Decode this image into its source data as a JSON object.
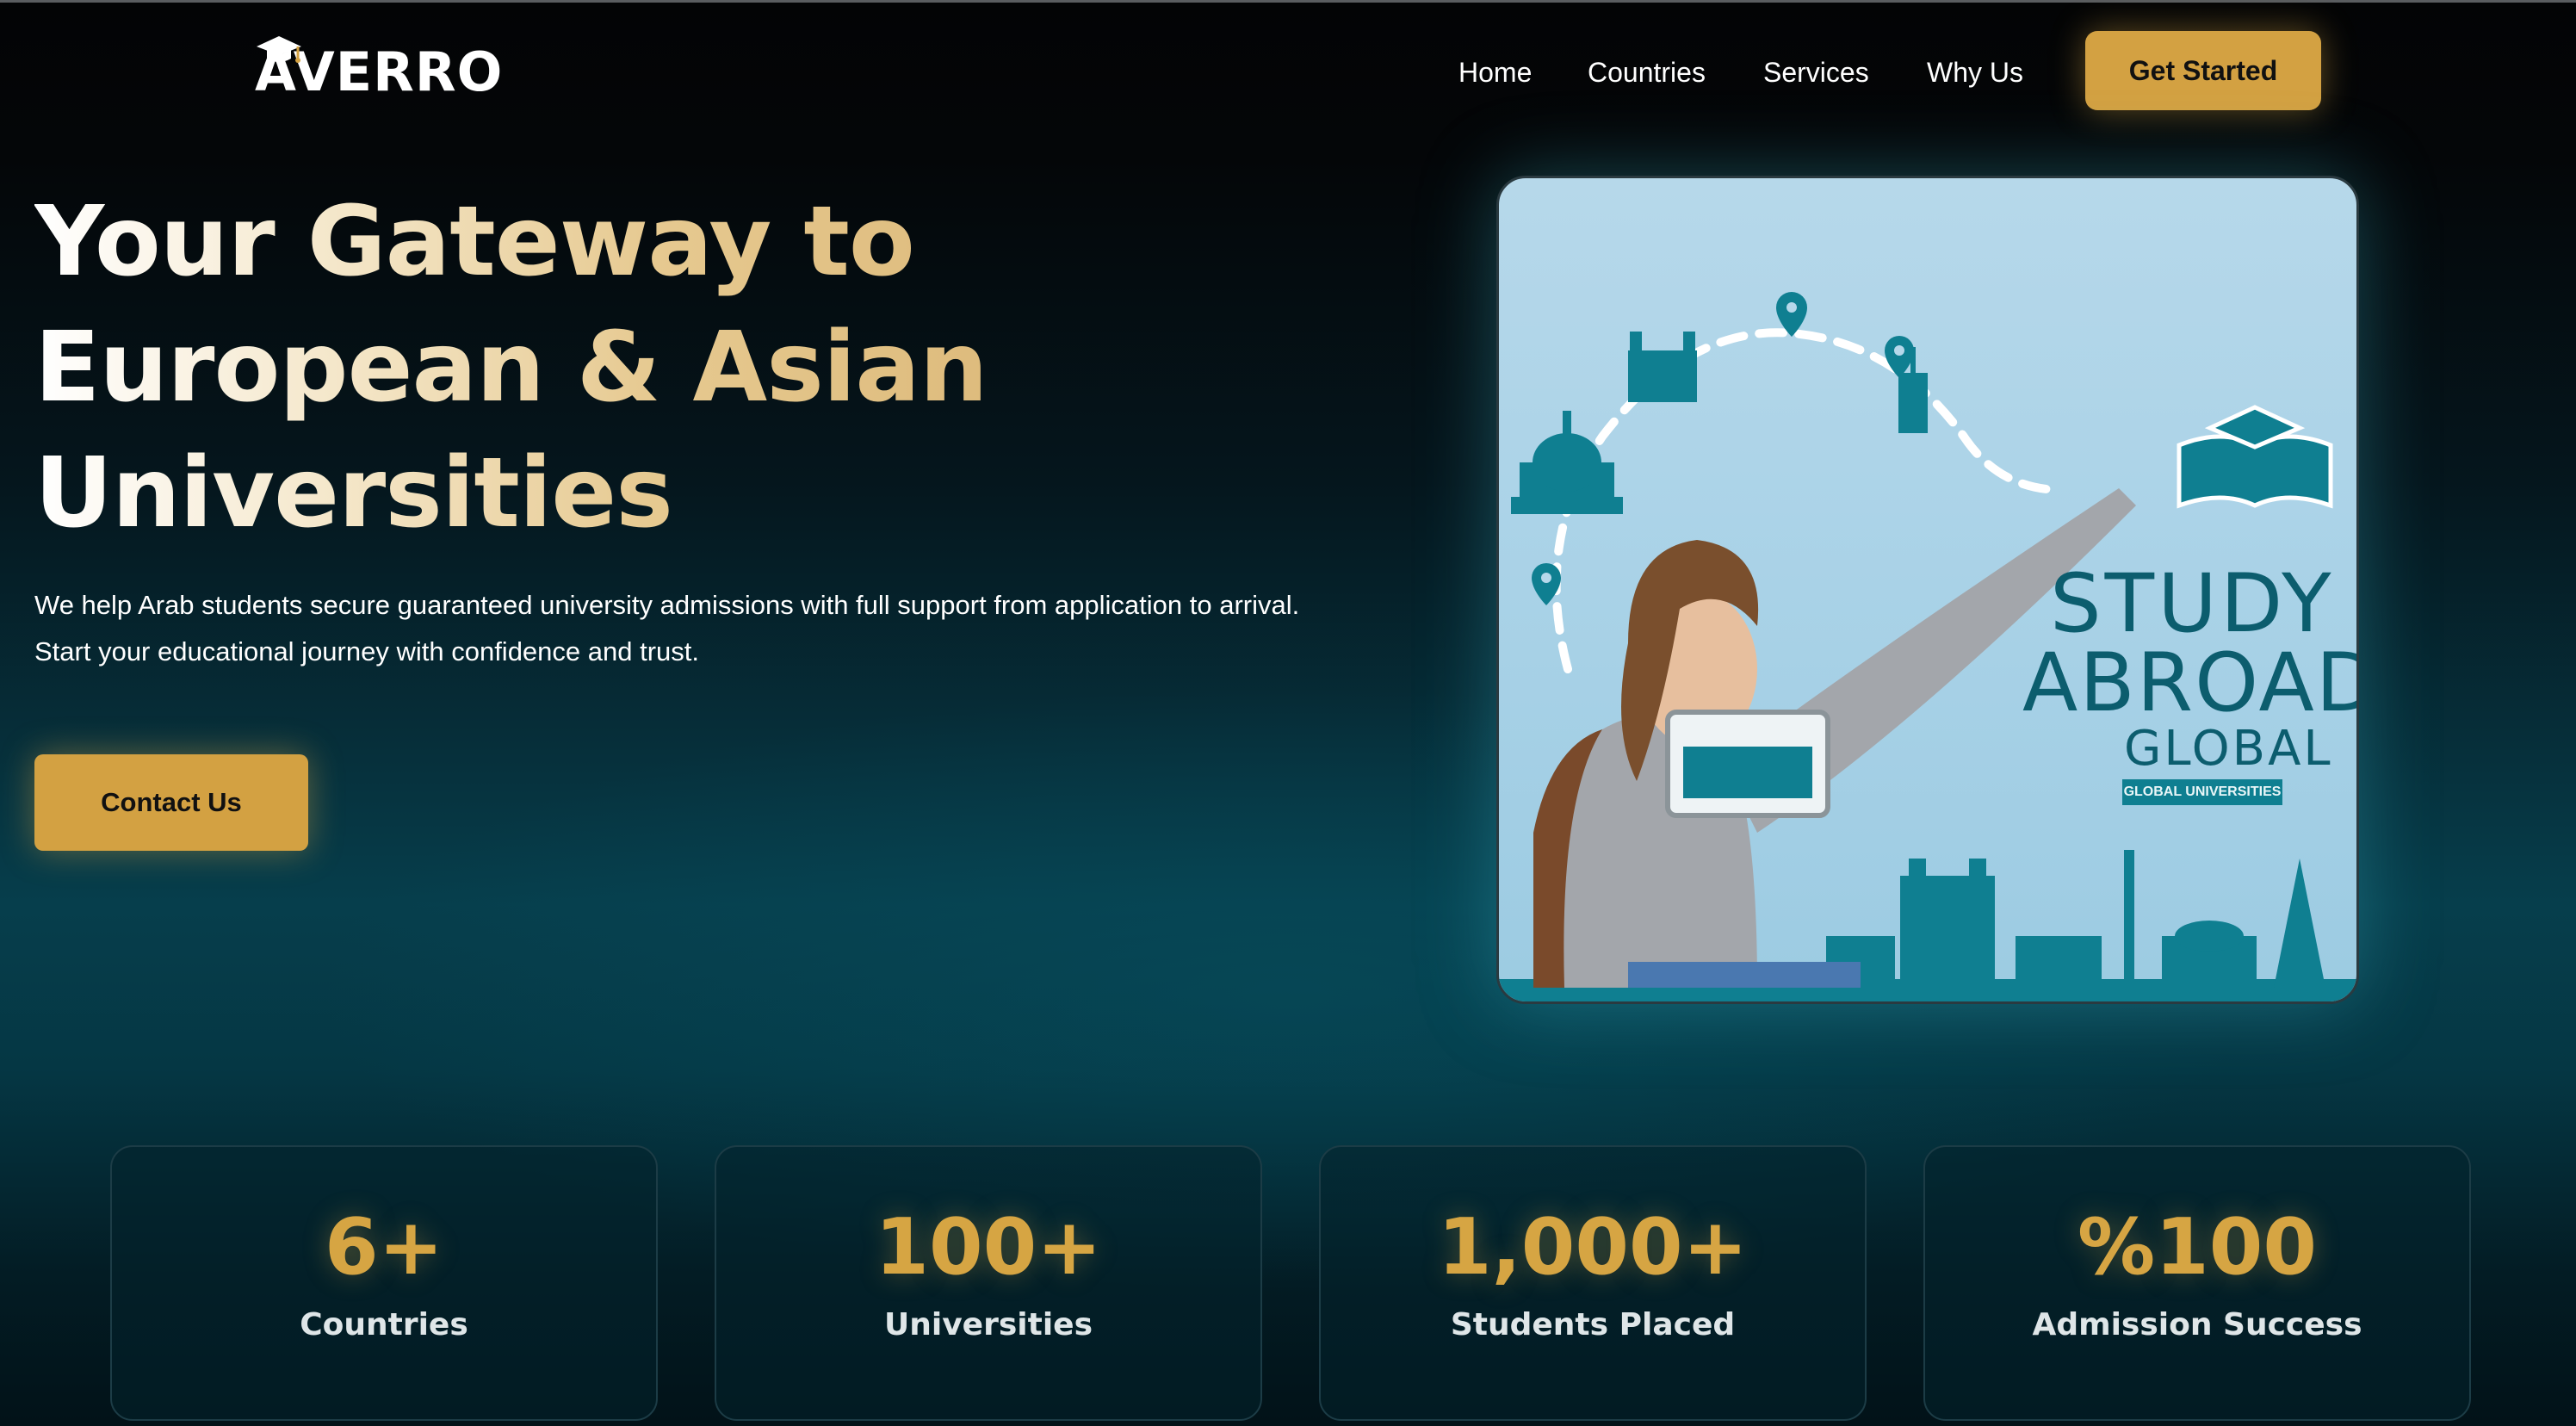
{
  "brand": {
    "logo_text": "AVERRO"
  },
  "nav": {
    "links": [
      "Home",
      "Countries",
      "Services",
      "Why Us"
    ],
    "cta": "Get Started"
  },
  "hero": {
    "title_lines": [
      "Your Gateway to",
      "European & Asian",
      "Universities"
    ],
    "description": "We help Arab students secure guaranteed university admissions with full support from application to arrival. Start your educational journey with confidence and trust.",
    "cta": "Contact Us",
    "image": {
      "headline_1": "STUDY",
      "headline_2": "ABROAD",
      "headline_3": "GLOBAL",
      "badge": "GLOBAL UNIVERSITIES"
    }
  },
  "stats": [
    {
      "value": "6+",
      "label": "Countries"
    },
    {
      "value": "100+",
      "label": "Universities"
    },
    {
      "value": "1,000+",
      "label": "Students Placed"
    },
    {
      "value": "%100",
      "label": "Admission Success"
    }
  ],
  "colors": {
    "accent_gold": "#d3a142",
    "teal": "#0c5d6e"
  }
}
